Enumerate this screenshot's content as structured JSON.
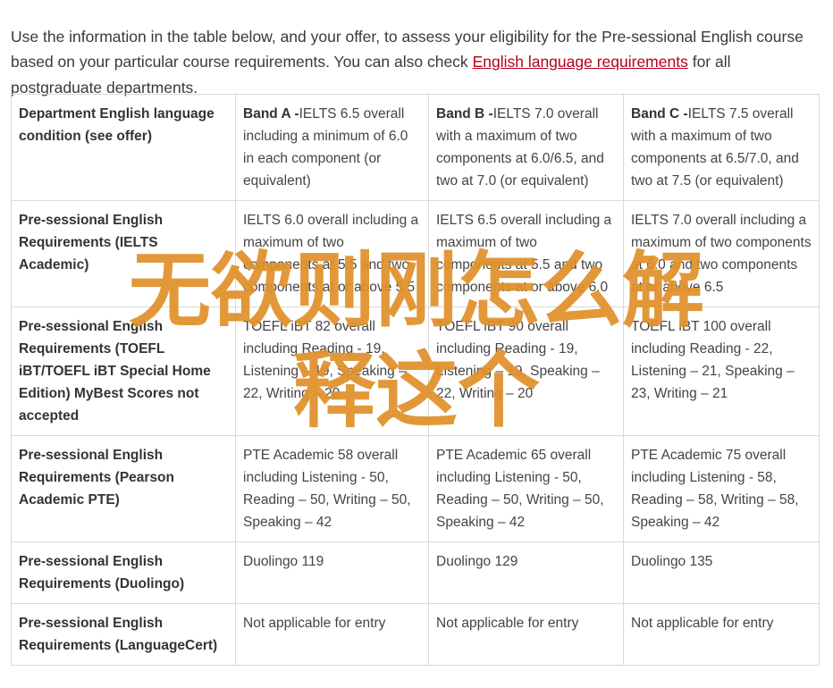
{
  "intro": {
    "text_before": "Use the information in the table below, and your offer, to assess your eligibility for the Pre-sessional English course based on your particular course requirements. You can also check ",
    "link": "English language requirements",
    "text_after": " for all postgraduate departments."
  },
  "table": {
    "header": {
      "label": "Department English language condition (see offer)",
      "bands": [
        {
          "name": "Band A -",
          "text": "IELTS 6.5 overall including a minimum of 6.0 in each component (or equivalent)"
        },
        {
          "name": "Band B -",
          "text": "IELTS 7.0 overall with a maximum of two components at 6.0/6.5, and two at 7.0 (or equivalent)"
        },
        {
          "name": "Band C -",
          "text": "IELTS 7.5 overall with a maximum of two components at 6.5/7.0, and two at 7.5 (or equivalent)"
        }
      ]
    },
    "rows": [
      {
        "label": "Pre-sessional English Requirements (IELTS Academic)",
        "cells": [
          "IELTS 6.0 overall including a maximum of two components at 5.5 and two components at or above 5.5",
          "IELTS 6.5 overall including a maximum of two components at 5.5 and two components at or above 6.0",
          "IELTS 7.0 overall including a maximum of two components at 6.0 and two components at or above 6.5"
        ]
      },
      {
        "label": "Pre-sessional English Requirements (TOEFL iBT/TOEFL iBT Special Home Edition) MyBest Scores not accepted",
        "cells": [
          "TOEFL iBT 82 overall including Reading - 19, Listening – 19, Speaking – 22, Writing – 20",
          "TOEFL iBT 90 overall including Reading - 19, Listening – 19, Speaking – 22, Writing – 20",
          "TOEFL iBT 100 overall including Reading - 22, Listening – 21, Speaking – 23, Writing – 21"
        ]
      },
      {
        "label": "Pre-sessional English Requirements (Pearson Academic PTE)",
        "cells": [
          "PTE Academic 58 overall including Listening - 50, Reading – 50, Writing – 50, Speaking – 42",
          "PTE Academic 65 overall including Listening - 50, Reading – 50, Writing – 50, Speaking – 42",
          "PTE Academic 75 overall including Listening - 58, Reading – 58, Writing – 58, Speaking – 42"
        ]
      },
      {
        "label": "Pre-sessional English Requirements (Duolingo)",
        "cells": [
          "Duolingo 119",
          "Duolingo 129",
          "Duolingo 135"
        ]
      },
      {
        "label": "Pre-sessional English Requirements (LanguageCert)",
        "cells": [
          "Not applicable for entry",
          "Not applicable for entry",
          "Not applicable for entry"
        ]
      }
    ]
  },
  "overlay": {
    "line1": "无欲则刚怎么解",
    "line2": "释这个",
    "color": "#e0912b"
  },
  "colors": {
    "link": "#b5001f",
    "border": "#d9d9d9",
    "text": "#444444"
  }
}
